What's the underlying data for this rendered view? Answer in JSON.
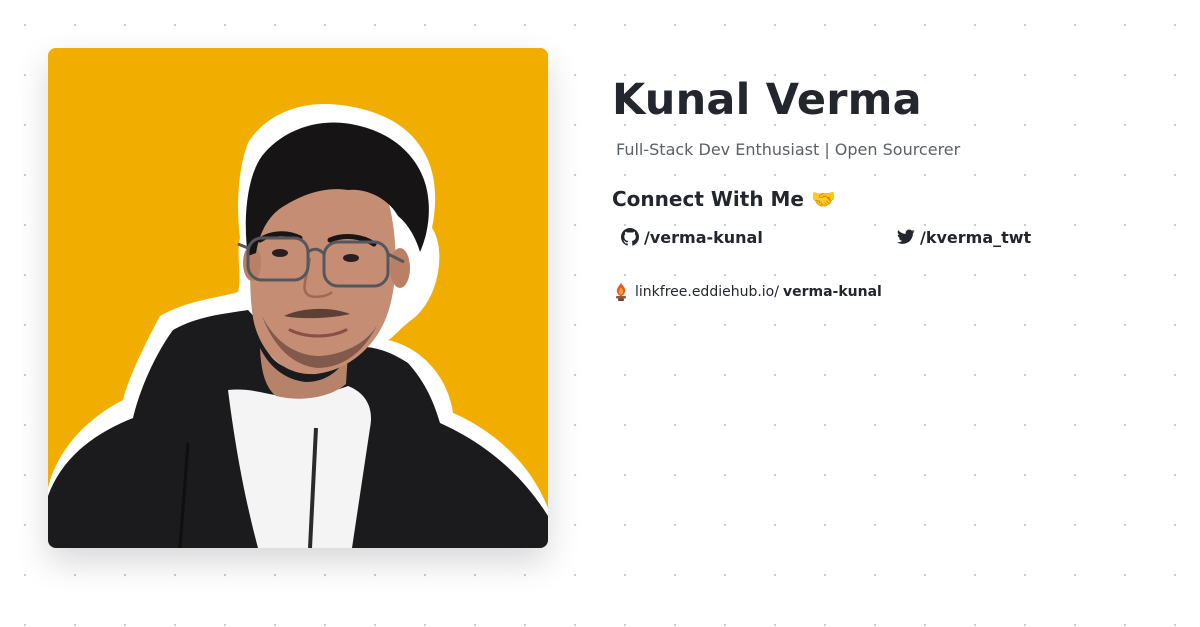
{
  "profile": {
    "name": "Kunal Verma",
    "tagline": "Full-Stack Dev Enthusiast | Open Sourcerer",
    "photo_background": "#f2ae00"
  },
  "connect": {
    "heading": "Connect With Me",
    "heading_emoji": "🤝",
    "links": [
      {
        "icon": "github-icon",
        "label": "/verma-kunal"
      },
      {
        "icon": "twitter-icon",
        "label": "/kverma_twt"
      }
    ]
  },
  "linkfree": {
    "icon": "linkfree-logo-icon",
    "domain": "linkfree.eddiehub.io/",
    "username": "verma-kunal"
  }
}
